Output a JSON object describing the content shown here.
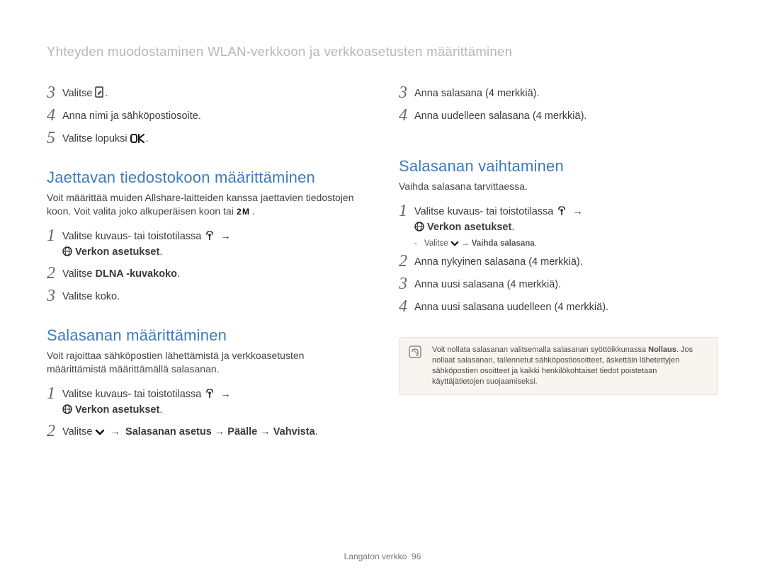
{
  "header": "Yhteyden muodostaminen WLAN-verkkoon ja verkkoasetusten määrittäminen",
  "left": {
    "initial": {
      "3": {
        "pre": "Valitse ",
        "post": "."
      },
      "4": "Anna nimi ja sähköpostiosoite.",
      "5": {
        "pre": "Valitse lopuksi ",
        "ok": "o",
        "post": "."
      }
    },
    "sec1": {
      "title": "Jaettavan tiedostokoon määrittäminen",
      "lead_a": "Voit määrittää muiden Allshare-laitteiden kanssa jaettavien tiedostojen koon. Voit valita joko alkuperäisen koon tai ",
      "lead_b": ".",
      "s1": {
        "pre": "Valitse kuvaus- tai toistotilassa ",
        "mid": " → ",
        "label": "Verkon asetukset",
        "post": "."
      },
      "s2": {
        "pre": "Valitse ",
        "bold": "DLNA -kuvakoko",
        "post": "."
      },
      "s3": "Valitse koko."
    },
    "sec2": {
      "title": "Salasanan määrittäminen",
      "lead": "Voit rajoittaa sähköpostien lähettämistä ja verkkoasetusten määrittämistä määrittämällä salasanan.",
      "s1": {
        "pre": "Valitse kuvaus- tai toistotilassa ",
        "mid": " → ",
        "label": "Verkon asetukset",
        "post": "."
      },
      "s2": {
        "pre": "Valitse ",
        "mid": " → ",
        "chain": "Salasanan asetus → Päälle → Vahvista",
        "post": "."
      }
    }
  },
  "right": {
    "initial": {
      "3": "Anna salasana (4 merkkiä).",
      "4": "Anna uudelleen salasana (4 merkkiä)."
    },
    "sec1": {
      "title": "Salasanan vaihtaminen",
      "lead": "Vaihda salasana tarvittaessa.",
      "s1": {
        "pre": "Valitse kuvaus- tai toistotilassa ",
        "mid": " → ",
        "label": "Verkon asetukset",
        "post": "."
      },
      "note": {
        "pre": "Valitse ",
        "mid": " → ",
        "bold": "Vaihda salasana",
        "post": "."
      },
      "s2": "Anna nykyinen salasana (4 merkkiä).",
      "s3": "Anna uusi salasana (4 merkkiä).",
      "s4": "Anna uusi salasana uudelleen (4 merkkiä)."
    },
    "infobox": {
      "a": "Voit nollata salasanan valitsemalla salasanan syöttöikkunassa ",
      "b": "Nollaus",
      "c": ". Jos nollaat salasanan, tallennetut sähköpostiosoitteet, äskettäin lähetettyjen sähköpostien osoitteet ja kaikki henkilökohtaiset tiedot poistetaan käyttäjätietojen suojaamiseksi."
    }
  },
  "footer": {
    "text": "Langaton verkko",
    "page": "96"
  }
}
